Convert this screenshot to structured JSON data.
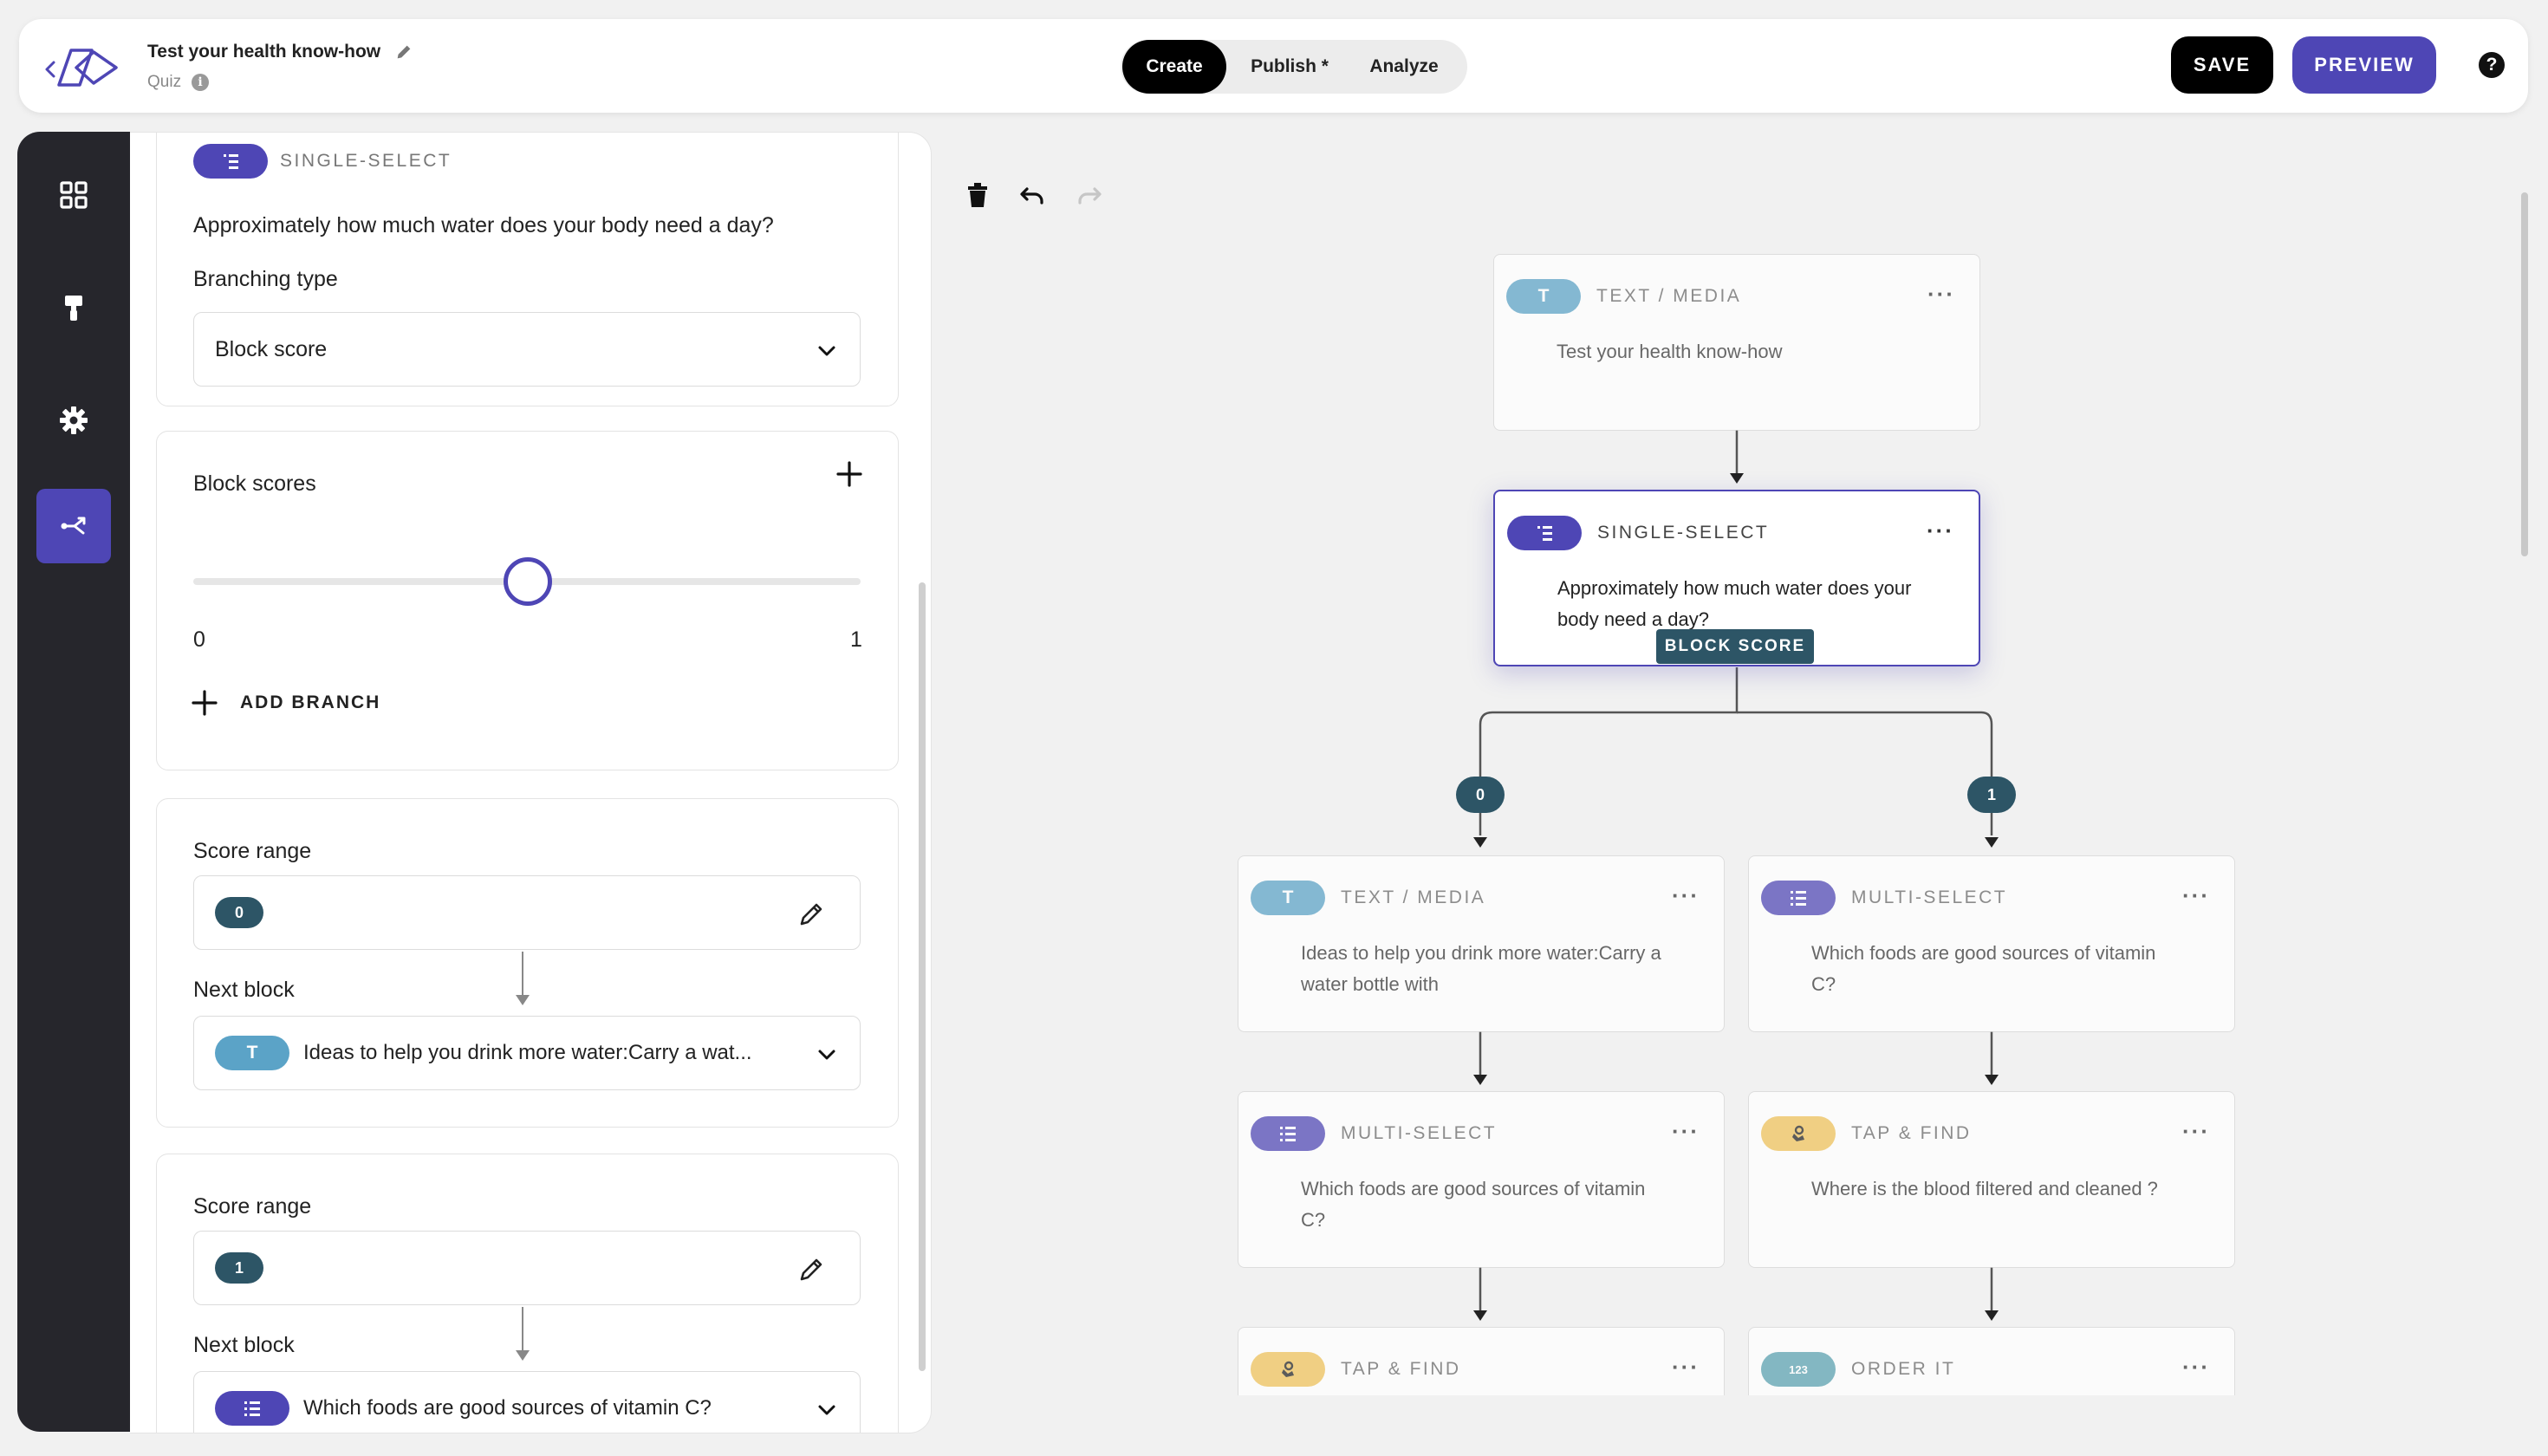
{
  "header": {
    "title": "Test your health know-how",
    "subtitle": "Quiz",
    "modes": [
      "Create",
      "Publish *",
      "Analyze"
    ],
    "active_mode": "Create",
    "save_label": "SAVE",
    "preview_label": "PREVIEW"
  },
  "rail": {
    "items": [
      "grid-icon",
      "paint-roller-icon",
      "gear-icon",
      "branching-icon"
    ],
    "active": "branching-icon"
  },
  "panel": {
    "block_type": "SINGLE-SELECT",
    "question": "Approximately how much water does your body need a day?",
    "branching_type_label": "Branching type",
    "branching_type_value": "Block score",
    "block_scores_label": "Block scores",
    "slider": {
      "min": "0",
      "max": "1",
      "value": 0.5
    },
    "add_branch_label": "ADD BRANCH",
    "ranges": [
      {
        "score_range_label": "Score range",
        "score": "0",
        "next_block_label": "Next block",
        "next_block_type_icon": "T",
        "next_block_value": "Ideas to help you drink more water:Carry a wat..."
      },
      {
        "score_range_label": "Score range",
        "score": "1",
        "next_block_label": "Next block",
        "next_block_type_icon": "list-icon",
        "next_block_value": "Which foods are good sources of vitamin C?"
      }
    ]
  },
  "canvas": {
    "nodes": [
      {
        "type": "TEXT / MEDIA",
        "icon": "T",
        "text": "Test your health know-how"
      },
      {
        "type": "SINGLE-SELECT",
        "icon": "list-icon",
        "text": "Approximately how much water does your body need a day?",
        "badge": "BLOCK SCORE"
      },
      {
        "type": "TEXT / MEDIA",
        "icon": "T",
        "text": "Ideas to help you drink more water:Carry a water bottle with"
      },
      {
        "type": "MULTI-SELECT",
        "icon": "list-icon",
        "text": "Which foods are good sources of vitamin C?"
      },
      {
        "type": "MULTI-SELECT",
        "icon": "list-icon",
        "text": "Which foods are good sources of vitamin C?"
      },
      {
        "type": "TAP & FIND",
        "icon": "tap-icon",
        "text": "Where is the blood filtered and cleaned ?"
      },
      {
        "type": "TAP & FIND",
        "icon": "tap-icon",
        "text": ""
      },
      {
        "type": "ORDER IT",
        "icon": "123",
        "text": ""
      }
    ],
    "branch_labels": [
      "0",
      "1"
    ],
    "colors": {
      "accent": "#4e46b5",
      "teal": "#5ba3c7",
      "gold": "#f0c25a",
      "score": "#2d5566"
    }
  }
}
